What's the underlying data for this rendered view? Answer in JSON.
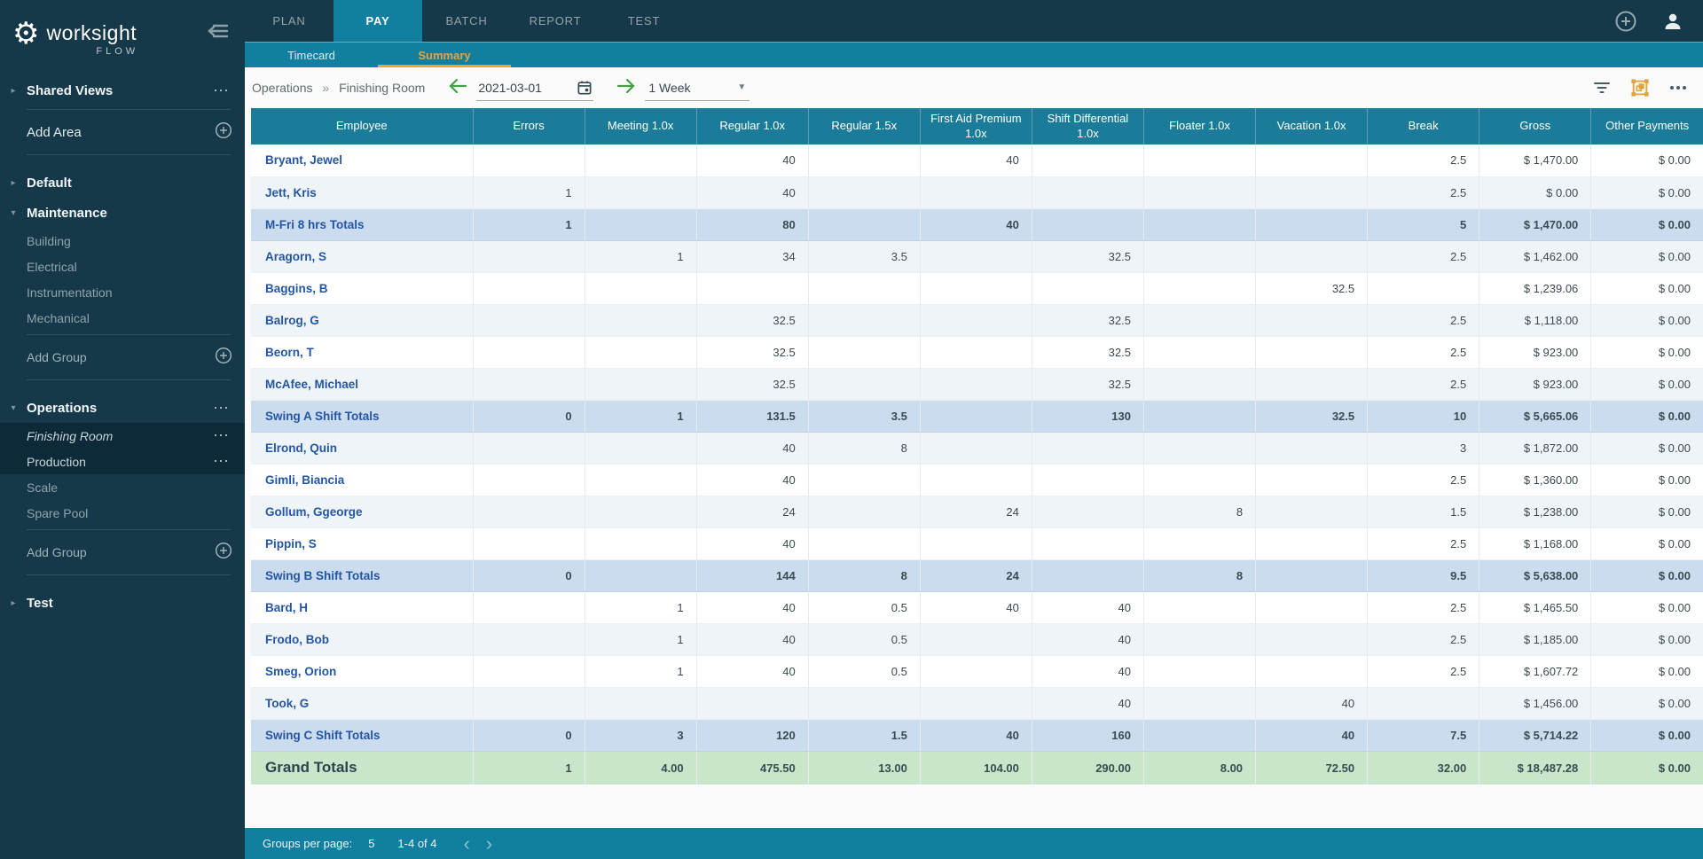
{
  "colors": {
    "dark_bar": "#16394a",
    "teal_accent": "#1180a0",
    "table_header": "#1a7c99",
    "active_tab_orange": "#e8a33d",
    "nav_arrow_green": "#43a047",
    "subtotal_row_bg": "#cbdcee",
    "grand_row_bg": "#c8e6c9",
    "shaded_row_bg": "#eff4f9",
    "employee_link_blue": "#2456a4",
    "selected_sidebar_bg": "#0c2a37"
  },
  "brand": {
    "name": "worksight",
    "suffix": "FLOW"
  },
  "topnav": {
    "tabs": [
      {
        "label": "PLAN",
        "active": false
      },
      {
        "label": "PAY",
        "active": true
      },
      {
        "label": "BATCH",
        "active": false
      },
      {
        "label": "REPORT",
        "active": false
      },
      {
        "label": "TEST",
        "active": false
      }
    ]
  },
  "subnav": {
    "tabs": [
      {
        "label": "Timecard",
        "active": false
      },
      {
        "label": "Summary",
        "active": true
      }
    ]
  },
  "toolbar": {
    "breadcrumb": {
      "area": "Operations",
      "separator": "»",
      "group": "Finishing Room"
    },
    "date": "2021-03-01",
    "period": "1 Week"
  },
  "sidebar": {
    "shared": {
      "label": "Shared Views"
    },
    "add_area": {
      "label": "Add Area"
    },
    "sections": [
      {
        "label": "Default",
        "expanded": false,
        "menu": false,
        "items": []
      },
      {
        "label": "Maintenance",
        "expanded": true,
        "menu": false,
        "items": [
          {
            "label": "Building"
          },
          {
            "label": "Electrical"
          },
          {
            "label": "Instrumentation"
          },
          {
            "label": "Mechanical"
          }
        ],
        "add": {
          "label": "Add Group"
        }
      },
      {
        "label": "Operations",
        "expanded": true,
        "menu": true,
        "items": [
          {
            "label": "Finishing Room",
            "selected": true,
            "italic": true,
            "menu": true
          },
          {
            "label": "Production",
            "selected": true,
            "menu": true
          },
          {
            "label": "Scale"
          },
          {
            "label": "Spare Pool"
          }
        ],
        "add": {
          "label": "Add Group"
        }
      },
      {
        "label": "Test",
        "expanded": false,
        "menu": false,
        "items": []
      }
    ]
  },
  "table": {
    "columns": [
      "Employee",
      "Errors",
      "Meeting 1.0x",
      "Regular 1.0x",
      "Regular 1.5x",
      "First Aid Premium 1.0x",
      "Shift Differential 1.0x",
      "Floater 1.0x",
      "Vacation 1.0x",
      "Break",
      "Gross",
      "Other Payments"
    ],
    "rows": [
      {
        "name": "Bryant, Jewel",
        "type": "data",
        "shaded": false,
        "cells": [
          "",
          "",
          "40",
          "",
          "40",
          "",
          "",
          "",
          "2.5",
          "$ 1,470.00",
          "$ 0.00"
        ]
      },
      {
        "name": "Jett, Kris",
        "type": "data",
        "shaded": true,
        "cells": [
          "1",
          "",
          "40",
          "",
          "",
          "",
          "",
          "",
          "2.5",
          "$ 0.00",
          "$ 0.00"
        ]
      },
      {
        "name": "M-Fri 8 hrs Totals",
        "type": "subtotal",
        "shaded": false,
        "cells": [
          "1",
          "",
          "80",
          "",
          "40",
          "",
          "",
          "",
          "5",
          "$ 1,470.00",
          "$ 0.00"
        ]
      },
      {
        "name": "Aragorn, S",
        "type": "data",
        "shaded": true,
        "cells": [
          "",
          "1",
          "34",
          "3.5",
          "",
          "32.5",
          "",
          "",
          "2.5",
          "$ 1,462.00",
          "$ 0.00"
        ]
      },
      {
        "name": "Baggins, B",
        "type": "data",
        "shaded": false,
        "cells": [
          "",
          "",
          "",
          "",
          "",
          "",
          "",
          "32.5",
          "",
          "$ 1,239.06",
          "$ 0.00"
        ]
      },
      {
        "name": "Balrog, G",
        "type": "data",
        "shaded": true,
        "cells": [
          "",
          "",
          "32.5",
          "",
          "",
          "32.5",
          "",
          "",
          "2.5",
          "$ 1,118.00",
          "$ 0.00"
        ]
      },
      {
        "name": "Beorn, T",
        "type": "data",
        "shaded": false,
        "cells": [
          "",
          "",
          "32.5",
          "",
          "",
          "32.5",
          "",
          "",
          "2.5",
          "$ 923.00",
          "$ 0.00"
        ]
      },
      {
        "name": "McAfee, Michael",
        "type": "data",
        "shaded": true,
        "cells": [
          "",
          "",
          "32.5",
          "",
          "",
          "32.5",
          "",
          "",
          "2.5",
          "$ 923.00",
          "$ 0.00"
        ]
      },
      {
        "name": "Swing A Shift Totals",
        "type": "subtotal",
        "shaded": false,
        "cells": [
          "0",
          "1",
          "131.5",
          "3.5",
          "",
          "130",
          "",
          "32.5",
          "10",
          "$ 5,665.06",
          "$ 0.00"
        ]
      },
      {
        "name": "Elrond, Quin",
        "type": "data",
        "shaded": true,
        "cells": [
          "",
          "",
          "40",
          "8",
          "",
          "",
          "",
          "",
          "3",
          "$ 1,872.00",
          "$ 0.00"
        ]
      },
      {
        "name": "Gimli, Biancia",
        "type": "data",
        "shaded": false,
        "cells": [
          "",
          "",
          "40",
          "",
          "",
          "",
          "",
          "",
          "2.5",
          "$ 1,360.00",
          "$ 0.00"
        ]
      },
      {
        "name": "Gollum, Ggeorge",
        "type": "data",
        "shaded": true,
        "cells": [
          "",
          "",
          "24",
          "",
          "24",
          "",
          "8",
          "",
          "1.5",
          "$ 1,238.00",
          "$ 0.00"
        ]
      },
      {
        "name": "Pippin, S",
        "type": "data",
        "shaded": false,
        "cells": [
          "",
          "",
          "40",
          "",
          "",
          "",
          "",
          "",
          "2.5",
          "$ 1,168.00",
          "$ 0.00"
        ]
      },
      {
        "name": "Swing B Shift Totals",
        "type": "subtotal",
        "shaded": false,
        "cells": [
          "0",
          "",
          "144",
          "8",
          "24",
          "",
          "8",
          "",
          "9.5",
          "$ 5,638.00",
          "$ 0.00"
        ]
      },
      {
        "name": "Bard, H",
        "type": "data",
        "shaded": false,
        "cells": [
          "",
          "1",
          "40",
          "0.5",
          "40",
          "40",
          "",
          "",
          "2.5",
          "$ 1,465.50",
          "$ 0.00"
        ]
      },
      {
        "name": "Frodo, Bob",
        "type": "data",
        "shaded": true,
        "cells": [
          "",
          "1",
          "40",
          "0.5",
          "",
          "40",
          "",
          "",
          "2.5",
          "$ 1,185.00",
          "$ 0.00"
        ]
      },
      {
        "name": "Smeg, Orion",
        "type": "data",
        "shaded": false,
        "cells": [
          "",
          "1",
          "40",
          "0.5",
          "",
          "40",
          "",
          "",
          "2.5",
          "$ 1,607.72",
          "$ 0.00"
        ]
      },
      {
        "name": "Took, G",
        "type": "data",
        "shaded": true,
        "cells": [
          "",
          "",
          "",
          "",
          "",
          "40",
          "",
          "40",
          "",
          "$ 1,456.00",
          "$ 0.00"
        ]
      },
      {
        "name": "Swing C Shift Totals",
        "type": "subtotal",
        "shaded": false,
        "cells": [
          "0",
          "3",
          "120",
          "1.5",
          "40",
          "160",
          "",
          "40",
          "7.5",
          "$ 5,714.22",
          "$ 0.00"
        ]
      },
      {
        "name": "Grand Totals",
        "type": "grand",
        "shaded": false,
        "cells": [
          "1",
          "4.00",
          "475.50",
          "13.00",
          "104.00",
          "290.00",
          "8.00",
          "72.50",
          "32.00",
          "$ 18,487.28",
          "$ 0.00"
        ]
      }
    ]
  },
  "footer": {
    "groups_per_page_label": "Groups per page:",
    "page_size": "5",
    "range": "1-4 of 4"
  }
}
